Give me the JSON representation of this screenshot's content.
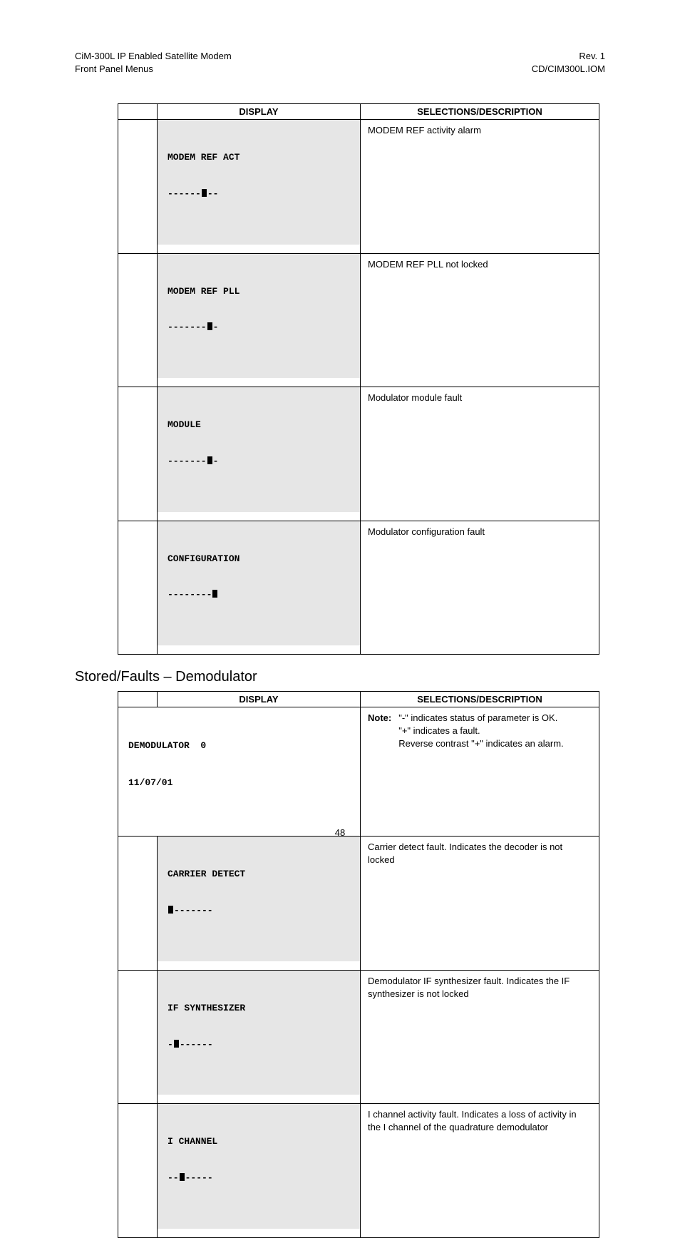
{
  "header": {
    "left1": "CiM-300L IP Enabled Satellite Modem",
    "left2": "Front Panel Menus",
    "right1": "Rev. 1",
    "right2": "CD/CIM300L.IOM"
  },
  "page_number": "48",
  "table1": {
    "col1": "DISPLAY",
    "col2": "SELECTIONS/DESCRIPTION",
    "rows": [
      {
        "display_l1": "MODEM REF ACT",
        "display_l2_a": "------",
        "display_l2_b": "--",
        "desc": "MODEM REF activity alarm"
      },
      {
        "display_l1": "MODEM REF PLL",
        "display_l2_a": "-------",
        "display_l2_b": "-",
        "desc": "MODEM REF PLL not locked"
      },
      {
        "display_l1": "MODULE",
        "display_l2_a": "-------",
        "display_l2_b": "-",
        "desc": "Modulator module fault"
      },
      {
        "display_l1": "CONFIGURATION",
        "display_l2_a": "--------",
        "display_l2_b": "",
        "desc": "Modulator configuration fault"
      }
    ]
  },
  "section_title": "Stored/Faults – Demodulator",
  "table2": {
    "col1": "DISPLAY",
    "col2": "SELECTIONS/DESCRIPTION",
    "header_row": {
      "display_l1": "DEMODULATOR  0",
      "display_l2": "11/07/01",
      "note_label": "Note:",
      "note_l1": "\"-\" indicates status of parameter is OK.",
      "note_l2": "\"+\" indicates a fault.",
      "note_l3": "Reverse contrast \"+\" indicates an alarm."
    },
    "rows": [
      {
        "display_l1": "CARRIER DETECT",
        "display_l2_a": "",
        "display_l2_b": "-------",
        "desc": "Carrier detect fault. Indicates the decoder is not locked"
      },
      {
        "display_l1": "IF SYNTHESIZER",
        "display_l2_a": "-",
        "display_l2_b": "------",
        "desc": "Demodulator IF synthesizer fault. Indicates the IF synthesizer is not locked"
      },
      {
        "display_l1": "I CHANNEL",
        "display_l2_a": "--",
        "display_l2_b": "-----",
        "desc": "I channel activity fault. Indicates a loss of activity in the I channel of the quadrature demodulator"
      }
    ]
  }
}
